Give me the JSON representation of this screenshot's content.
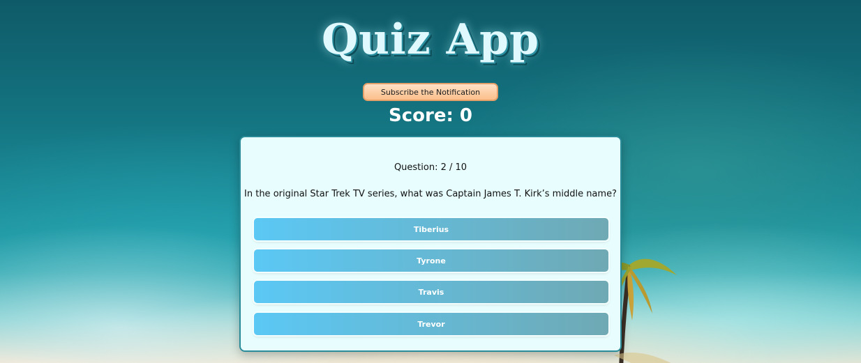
{
  "app": {
    "title": "Quiz App"
  },
  "subscribe_button": {
    "label": "Subscribe the Notification"
  },
  "score": {
    "text": "Score: 0"
  },
  "quiz": {
    "question_count": "Question: 2 / 10",
    "question": "In the original Star Trek TV series, what was Captain James T. Kirk’s middle name?",
    "answers": [
      {
        "label": "Tiberius"
      },
      {
        "label": "Tyrone"
      },
      {
        "label": "Travis"
      },
      {
        "label": "Trevor"
      }
    ]
  },
  "colors": {
    "title": "#dff9ff",
    "subscribe_bg": "#fbbf8a",
    "card_bg": "#e8fdfd",
    "card_border": "#2a8c98",
    "answer_left": "#5bc8f5",
    "answer_right": "#6fa9b4"
  }
}
